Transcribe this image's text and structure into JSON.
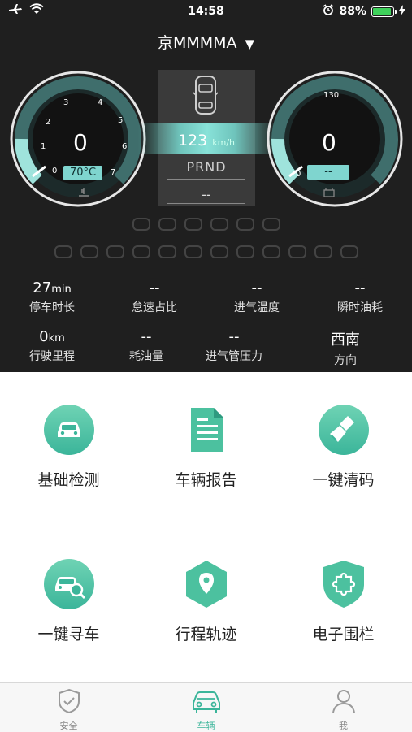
{
  "status_bar": {
    "time": "14:58",
    "battery": "88%"
  },
  "vehicle": {
    "plate": "京MMMMA"
  },
  "dashboard": {
    "left_gauge": {
      "value": "0",
      "badge": "70°C",
      "ticks": [
        "0",
        "1",
        "2",
        "3",
        "4",
        "5",
        "6",
        "7"
      ]
    },
    "right_gauge": {
      "value": "0",
      "badge": "--",
      "ticks": [
        "0",
        "130"
      ]
    },
    "speed": "123",
    "speed_unit": "km/h",
    "prnd": "PRND",
    "gear": "--"
  },
  "stats": [
    {
      "value": "27",
      "unit": "min",
      "label": "停车时长"
    },
    {
      "value": "--",
      "unit": "",
      "label": "怠速占比"
    },
    {
      "value": "--",
      "unit": "",
      "label": "进气温度"
    },
    {
      "value": "--",
      "unit": "",
      "label": "瞬时油耗"
    },
    {
      "value": "0",
      "unit": "km",
      "label": "行驶里程"
    },
    {
      "value": "--",
      "unit": "",
      "label": "耗油量"
    },
    {
      "value": "--",
      "unit": "",
      "label": "进气管压力"
    },
    {
      "value": "西南",
      "unit": "",
      "label": "方向"
    }
  ],
  "features": [
    {
      "label": "基础检测",
      "icon": "car-icon"
    },
    {
      "label": "车辆报告",
      "icon": "document-icon"
    },
    {
      "label": "一键清码",
      "icon": "broom-icon"
    },
    {
      "label": "一键寻车",
      "icon": "car-search-icon"
    },
    {
      "label": "行程轨迹",
      "icon": "location-pin-icon"
    },
    {
      "label": "电子围栏",
      "icon": "puzzle-shield-icon"
    }
  ],
  "tabs": [
    {
      "label": "安全",
      "icon": "shield-check-icon",
      "active": false
    },
    {
      "label": "车辆",
      "icon": "car-icon",
      "active": true
    },
    {
      "label": "我",
      "icon": "person-icon",
      "active": false
    }
  ],
  "colors": {
    "accent": "#3bb59a",
    "dark_bg": "#1f1f1f",
    "gauge_teal": "#7fd5cf"
  }
}
